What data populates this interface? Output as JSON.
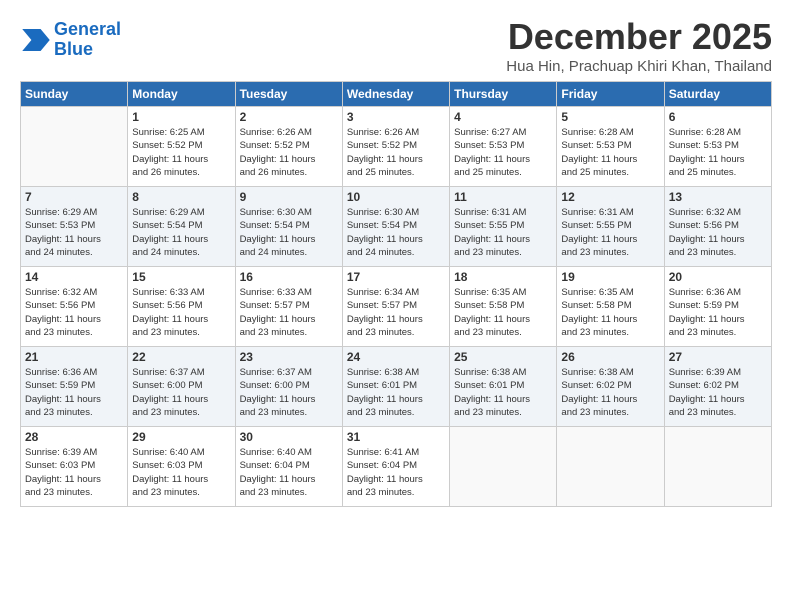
{
  "logo": {
    "line1": "General",
    "line2": "Blue"
  },
  "title": "December 2025",
  "location": "Hua Hin, Prachuap Khiri Khan, Thailand",
  "days_of_week": [
    "Sunday",
    "Monday",
    "Tuesday",
    "Wednesday",
    "Thursday",
    "Friday",
    "Saturday"
  ],
  "weeks": [
    [
      {
        "day": "",
        "info": ""
      },
      {
        "day": "1",
        "info": "Sunrise: 6:25 AM\nSunset: 5:52 PM\nDaylight: 11 hours\nand 26 minutes."
      },
      {
        "day": "2",
        "info": "Sunrise: 6:26 AM\nSunset: 5:52 PM\nDaylight: 11 hours\nand 26 minutes."
      },
      {
        "day": "3",
        "info": "Sunrise: 6:26 AM\nSunset: 5:52 PM\nDaylight: 11 hours\nand 25 minutes."
      },
      {
        "day": "4",
        "info": "Sunrise: 6:27 AM\nSunset: 5:53 PM\nDaylight: 11 hours\nand 25 minutes."
      },
      {
        "day": "5",
        "info": "Sunrise: 6:28 AM\nSunset: 5:53 PM\nDaylight: 11 hours\nand 25 minutes."
      },
      {
        "day": "6",
        "info": "Sunrise: 6:28 AM\nSunset: 5:53 PM\nDaylight: 11 hours\nand 25 minutes."
      }
    ],
    [
      {
        "day": "7",
        "info": "Sunrise: 6:29 AM\nSunset: 5:53 PM\nDaylight: 11 hours\nand 24 minutes."
      },
      {
        "day": "8",
        "info": "Sunrise: 6:29 AM\nSunset: 5:54 PM\nDaylight: 11 hours\nand 24 minutes."
      },
      {
        "day": "9",
        "info": "Sunrise: 6:30 AM\nSunset: 5:54 PM\nDaylight: 11 hours\nand 24 minutes."
      },
      {
        "day": "10",
        "info": "Sunrise: 6:30 AM\nSunset: 5:54 PM\nDaylight: 11 hours\nand 24 minutes."
      },
      {
        "day": "11",
        "info": "Sunrise: 6:31 AM\nSunset: 5:55 PM\nDaylight: 11 hours\nand 23 minutes."
      },
      {
        "day": "12",
        "info": "Sunrise: 6:31 AM\nSunset: 5:55 PM\nDaylight: 11 hours\nand 23 minutes."
      },
      {
        "day": "13",
        "info": "Sunrise: 6:32 AM\nSunset: 5:56 PM\nDaylight: 11 hours\nand 23 minutes."
      }
    ],
    [
      {
        "day": "14",
        "info": "Sunrise: 6:32 AM\nSunset: 5:56 PM\nDaylight: 11 hours\nand 23 minutes."
      },
      {
        "day": "15",
        "info": "Sunrise: 6:33 AM\nSunset: 5:56 PM\nDaylight: 11 hours\nand 23 minutes."
      },
      {
        "day": "16",
        "info": "Sunrise: 6:33 AM\nSunset: 5:57 PM\nDaylight: 11 hours\nand 23 minutes."
      },
      {
        "day": "17",
        "info": "Sunrise: 6:34 AM\nSunset: 5:57 PM\nDaylight: 11 hours\nand 23 minutes."
      },
      {
        "day": "18",
        "info": "Sunrise: 6:35 AM\nSunset: 5:58 PM\nDaylight: 11 hours\nand 23 minutes."
      },
      {
        "day": "19",
        "info": "Sunrise: 6:35 AM\nSunset: 5:58 PM\nDaylight: 11 hours\nand 23 minutes."
      },
      {
        "day": "20",
        "info": "Sunrise: 6:36 AM\nSunset: 5:59 PM\nDaylight: 11 hours\nand 23 minutes."
      }
    ],
    [
      {
        "day": "21",
        "info": "Sunrise: 6:36 AM\nSunset: 5:59 PM\nDaylight: 11 hours\nand 23 minutes."
      },
      {
        "day": "22",
        "info": "Sunrise: 6:37 AM\nSunset: 6:00 PM\nDaylight: 11 hours\nand 23 minutes."
      },
      {
        "day": "23",
        "info": "Sunrise: 6:37 AM\nSunset: 6:00 PM\nDaylight: 11 hours\nand 23 minutes."
      },
      {
        "day": "24",
        "info": "Sunrise: 6:38 AM\nSunset: 6:01 PM\nDaylight: 11 hours\nand 23 minutes."
      },
      {
        "day": "25",
        "info": "Sunrise: 6:38 AM\nSunset: 6:01 PM\nDaylight: 11 hours\nand 23 minutes."
      },
      {
        "day": "26",
        "info": "Sunrise: 6:38 AM\nSunset: 6:02 PM\nDaylight: 11 hours\nand 23 minutes."
      },
      {
        "day": "27",
        "info": "Sunrise: 6:39 AM\nSunset: 6:02 PM\nDaylight: 11 hours\nand 23 minutes."
      }
    ],
    [
      {
        "day": "28",
        "info": "Sunrise: 6:39 AM\nSunset: 6:03 PM\nDaylight: 11 hours\nand 23 minutes."
      },
      {
        "day": "29",
        "info": "Sunrise: 6:40 AM\nSunset: 6:03 PM\nDaylight: 11 hours\nand 23 minutes."
      },
      {
        "day": "30",
        "info": "Sunrise: 6:40 AM\nSunset: 6:04 PM\nDaylight: 11 hours\nand 23 minutes."
      },
      {
        "day": "31",
        "info": "Sunrise: 6:41 AM\nSunset: 6:04 PM\nDaylight: 11 hours\nand 23 minutes."
      },
      {
        "day": "",
        "info": ""
      },
      {
        "day": "",
        "info": ""
      },
      {
        "day": "",
        "info": ""
      }
    ]
  ]
}
